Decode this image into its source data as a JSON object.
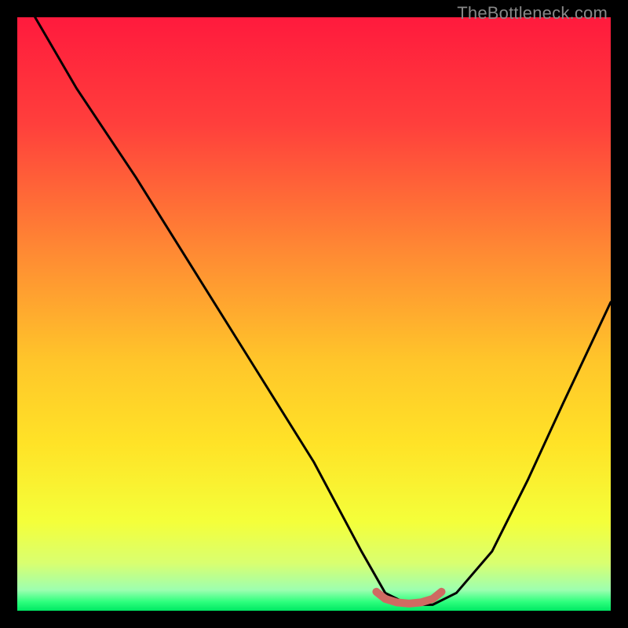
{
  "watermark": "TheBottleneck.com",
  "chart_data": {
    "type": "line",
    "title": "",
    "xlabel": "",
    "ylabel": "",
    "xlim": [
      0,
      100
    ],
    "ylim": [
      0,
      100
    ],
    "curve": {
      "name": "bottleneck-curve",
      "x": [
        3,
        10,
        20,
        30,
        40,
        50,
        58,
        62,
        66,
        70,
        74,
        80,
        86,
        92,
        100
      ],
      "y": [
        100,
        88,
        73,
        57,
        41,
        25,
        10,
        3,
        1,
        1,
        3,
        10,
        22,
        35,
        52
      ]
    },
    "highlight": {
      "name": "optimal-zone-marker",
      "x": [
        60.5,
        62.0,
        64.0,
        66.0,
        68.0,
        70.0,
        71.5
      ],
      "y": [
        3.2,
        2.0,
        1.4,
        1.2,
        1.4,
        2.0,
        3.2
      ]
    },
    "gradient_stops": [
      {
        "pos": 0.0,
        "color": "#ff1a3d"
      },
      {
        "pos": 0.18,
        "color": "#ff3f3c"
      },
      {
        "pos": 0.4,
        "color": "#ff8b33"
      },
      {
        "pos": 0.58,
        "color": "#ffc62a"
      },
      {
        "pos": 0.72,
        "color": "#ffe327"
      },
      {
        "pos": 0.85,
        "color": "#f4ff3a"
      },
      {
        "pos": 0.92,
        "color": "#d9ff70"
      },
      {
        "pos": 0.965,
        "color": "#9dffb0"
      },
      {
        "pos": 0.985,
        "color": "#2dff7d"
      },
      {
        "pos": 1.0,
        "color": "#00e863"
      }
    ],
    "colors": {
      "curve": "#000000",
      "highlight": "#cf6a62",
      "frame": "#000000"
    }
  }
}
